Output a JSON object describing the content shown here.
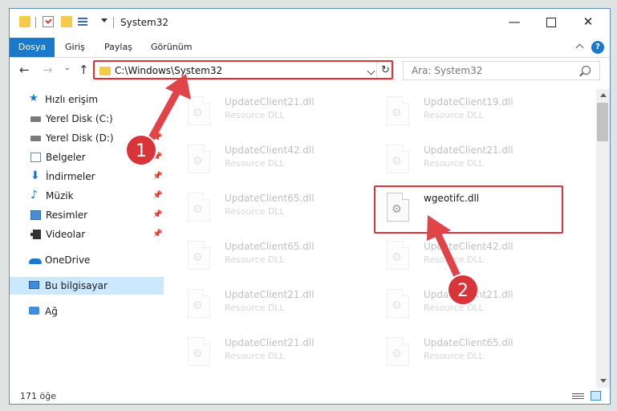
{
  "window": {
    "title": "System32",
    "controls": {
      "minimize": "—",
      "maximize": "",
      "close": "✕"
    }
  },
  "ribbon": {
    "tabs": [
      {
        "label": "Dosya"
      },
      {
        "label": "Giriş"
      },
      {
        "label": "Paylaş"
      },
      {
        "label": "Görünüm"
      }
    ],
    "help": "?"
  },
  "navigation": {
    "back": "←",
    "forward": "→",
    "recent": "⌄",
    "up": "↑",
    "address": "C:\\Windows\\System32",
    "refresh": "↻",
    "search_placeholder": "Ara: System32"
  },
  "sidebar": {
    "items": [
      {
        "label": "Hızlı erişim",
        "icon": "star-icon",
        "pinned": false
      },
      {
        "label": "Yerel Disk (C:)",
        "icon": "disk-icon",
        "pinned": false
      },
      {
        "label": "Yerel Disk (D:)",
        "icon": "disk-icon",
        "pinned": true
      },
      {
        "label": "Belgeler",
        "icon": "documents-icon",
        "pinned": true
      },
      {
        "label": "İndirmeler",
        "icon": "downloads-icon",
        "pinned": true
      },
      {
        "label": "Müzik",
        "icon": "music-icon",
        "pinned": true
      },
      {
        "label": "Resimler",
        "icon": "pictures-icon",
        "pinned": true
      },
      {
        "label": "Videolar",
        "icon": "videos-icon",
        "pinned": true
      },
      {
        "label": "OneDrive",
        "icon": "cloud-icon",
        "pinned": false
      },
      {
        "label": "Bu bilgisayar",
        "icon": "computer-icon",
        "pinned": false,
        "selected": true
      },
      {
        "label": "Ağ",
        "icon": "network-icon",
        "pinned": false
      }
    ]
  },
  "files": {
    "left_column": [
      {
        "name": "UpdateClient21.dll",
        "type": "Resource DLL"
      },
      {
        "name": "UpdateClient42.dll",
        "type": "Resource DLL"
      },
      {
        "name": "UpdateClient65.dll",
        "type": "Resource DLL"
      },
      {
        "name": "UpdateClient65.dll",
        "type": "Resource DLL"
      },
      {
        "name": "UpdateClient21.dll",
        "type": "Resource DLL"
      },
      {
        "name": "UpdateClient21.dll",
        "type": "Resource DLL"
      }
    ],
    "right_column": [
      {
        "name": "UpdateClient19.dll",
        "type": "Resource DLL"
      },
      {
        "name": "UpdateClient21.dll",
        "type": "Resource DLL"
      },
      {
        "name": "wgeotifc.dll",
        "type": ""
      },
      {
        "name": "UpdateClient42.dll",
        "type": "Resource DLL"
      },
      {
        "name": "UpdateClient21.dll",
        "type": "Resource DLL"
      },
      {
        "name": "UpdateClient65.dll",
        "type": "Resource DLL"
      }
    ]
  },
  "status": {
    "item_count": "171 öğe"
  },
  "annotations": {
    "badges": [
      "1",
      "2"
    ],
    "accent_color": "#d8343a"
  }
}
